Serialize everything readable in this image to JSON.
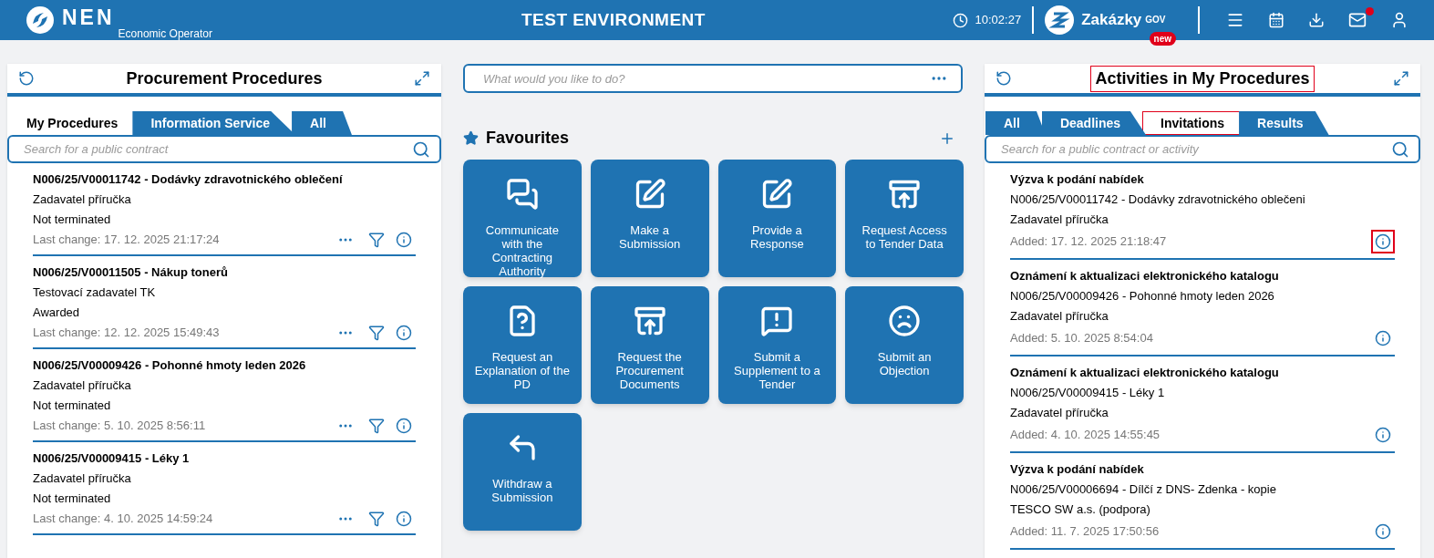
{
  "header": {
    "brand": "NEN",
    "subtitle": "Economic Operator",
    "environment": "TEST ENVIRONMENT",
    "time": "10:02:27",
    "portal": {
      "name": "Zakázky",
      "superscript": "GOV",
      "badge": "new"
    },
    "mail_unread": true
  },
  "procedures": {
    "title": "Procurement Procedures",
    "tabs": [
      {
        "label": "My Procedures",
        "selected": true
      },
      {
        "label": "Information Service",
        "selected": false
      },
      {
        "label": "All",
        "selected": false
      }
    ],
    "search": {
      "placeholder": "Search for a public contract"
    },
    "items": [
      {
        "title": "N006/25/V00011742 - Dodávky zdravotnického oblečení",
        "authority": "Zadavatel příručka",
        "status": "Not terminated",
        "changed": "Last change: 17. 12. 2025 21:17:24"
      },
      {
        "title": "N006/25/V00011505 - Nákup tonerů",
        "authority": "Testovací zadavatel TK",
        "status": "Awarded",
        "changed": "Last change: 12. 12. 2025 15:49:43"
      },
      {
        "title": "N006/25/V00009426 - Pohonné hmoty leden 2026",
        "authority": "Zadavatel příručka",
        "status": "Not terminated",
        "changed": "Last change: 5. 10. 2025 8:56:11"
      },
      {
        "title": "N006/25/V00009415 - Léky 1",
        "authority": "Zadavatel příručka",
        "status": "Not terminated",
        "changed": "Last change: 4. 10. 2025 14:59:24"
      }
    ]
  },
  "center": {
    "search": {
      "placeholder": "What would you like to do?"
    },
    "favourites_title": "Favourites",
    "tiles": [
      {
        "kind": "chat",
        "label": "Communicate with the Contracting Authority"
      },
      {
        "kind": "edit",
        "label": "Make a Submission"
      },
      {
        "kind": "edit",
        "label": "Provide a Response"
      },
      {
        "kind": "upload",
        "label": "Request Access to Tender Data"
      },
      {
        "kind": "question",
        "label": "Request an Explanation of the PD"
      },
      {
        "kind": "upload",
        "label": "Request the Procurement Documents"
      },
      {
        "kind": "alert",
        "label": "Submit a Supplement to a Tender"
      },
      {
        "kind": "sad",
        "label": "Submit an Objection"
      },
      {
        "kind": "return",
        "label": "Withdraw a Submission"
      }
    ]
  },
  "activities": {
    "title": "Activities in My Procedures",
    "title_highlighted": true,
    "tabs": [
      {
        "label": "All",
        "selected": false,
        "highlighted": false
      },
      {
        "label": "Deadlines",
        "selected": false,
        "highlighted": false
      },
      {
        "label": "Invitations",
        "selected": true,
        "highlighted": true
      },
      {
        "label": "Results",
        "selected": false,
        "highlighted": false
      }
    ],
    "search": {
      "placeholder": "Search for a public contract or activity"
    },
    "items": [
      {
        "title": "Výzva k podání nabídek",
        "procedure": "N006/25/V00011742 - Dodávky zdravotnického oblečeni",
        "authority": "Zadavatel příručka",
        "added": "Added: 17. 12. 2025 21:18:47",
        "info_highlighted": true
      },
      {
        "title": "Oznámení k aktualizaci elektronického katalogu",
        "procedure": "N006/25/V00009426 - Pohonné hmoty leden 2026",
        "authority": "Zadavatel příručka",
        "added": "Added: 5. 10. 2025 8:54:04",
        "info_highlighted": false
      },
      {
        "title": "Oznámení k aktualizaci elektronického katalogu",
        "procedure": "N006/25/V00009415 - Léky 1",
        "authority": "Zadavatel příručka",
        "added": "Added: 4. 10. 2025 14:55:45",
        "info_highlighted": false
      },
      {
        "title": "Výzva k podání nabídek",
        "procedure": "N006/25/V00006694 - Dílčí z DNS- Zdenka - kopie",
        "authority": "TESCO SW a.s. (podpora)",
        "added": "Added: 11. 7. 2025 17:50:56",
        "info_highlighted": false
      }
    ]
  }
}
